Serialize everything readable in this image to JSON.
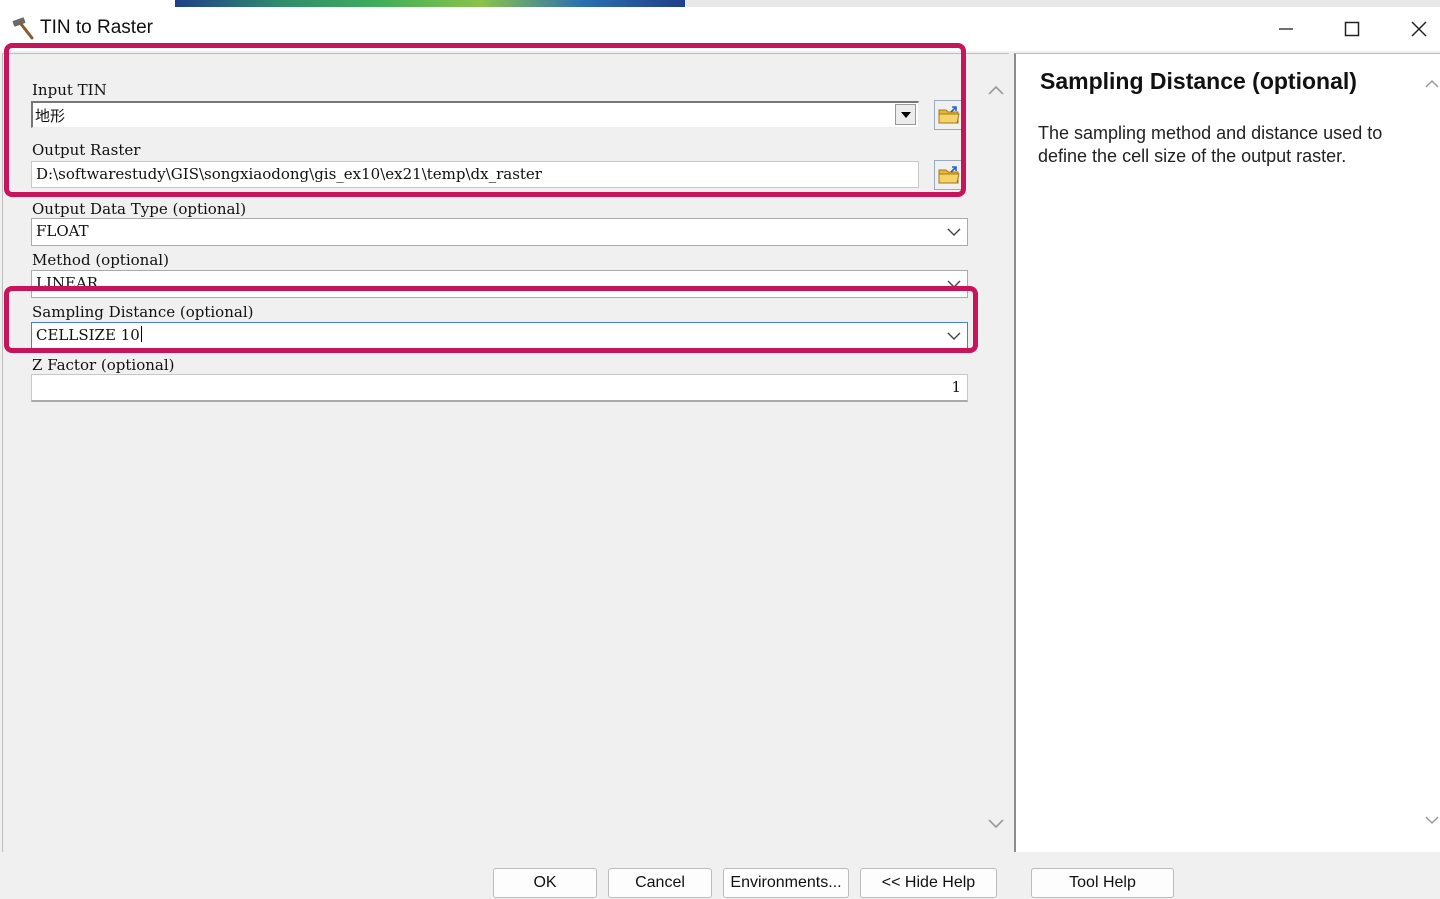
{
  "window": {
    "title": "TIN to Raster"
  },
  "form": {
    "input_tin": {
      "label": "Input TIN",
      "value": "地形"
    },
    "output_raster": {
      "label": "Output Raster",
      "value": "D:\\softwarestudy\\GIS\\songxiaodong\\gis_ex10\\ex21\\temp\\dx_raster"
    },
    "output_data_type": {
      "label": "Output Data Type (optional)",
      "value": "FLOAT"
    },
    "method": {
      "label": "Method (optional)",
      "value": "LINEAR"
    },
    "sampling_distance": {
      "label": "Sampling Distance (optional)",
      "value": "CELLSIZE 10"
    },
    "z_factor": {
      "label": "Z Factor (optional)",
      "value": "1"
    }
  },
  "help": {
    "title": "Sampling Distance (optional)",
    "body": "The sampling method and distance used to define the cell size of the output raster."
  },
  "buttons": {
    "ok": "OK",
    "cancel": "Cancel",
    "environments": "Environments...",
    "hide_help": "<< Hide Help",
    "tool_help": "Tool Help"
  },
  "colors": {
    "highlight": "#c8145a"
  }
}
